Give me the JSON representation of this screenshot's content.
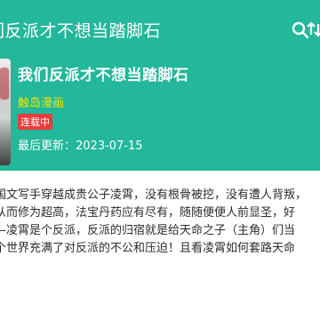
{
  "appbar": {
    "title": "们反派才不想当踏脚石",
    "search_icon": "search-icon",
    "sort_icon": "sort-icon"
  },
  "book": {
    "title": "我们反派才不想当踏脚石",
    "author": "触岛漫画",
    "status": "连载中",
    "updated": "最后更新：2023-07-15"
  },
  "description": {
    "line1": "国文写手穿越成贵公子凌霄，没有根骨被挖，没有遭人背叛，",
    "line2": "从而修为超高，法宝丹药应有尽有，随随便便人前显圣，好",
    "line3": "—凌霄是个反派，反派的归宿就是给天命之子（主角）们当",
    "line4": "个世界充满了对反派的不公和压迫！且看凌霄如何套路天命"
  },
  "colors": {
    "primary": "#23b79b",
    "author": "#f5e400",
    "badge": "#e83d3d"
  }
}
